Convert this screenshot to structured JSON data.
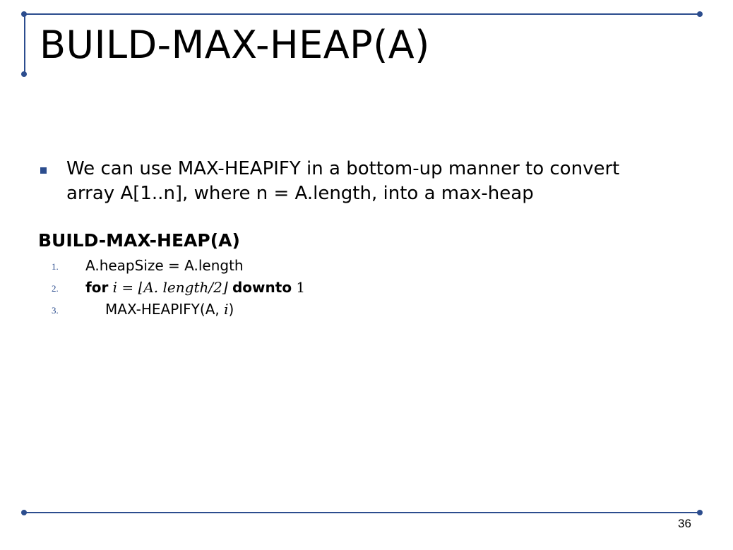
{
  "slide": {
    "title": "BUILD-MAX-HEAP(A)",
    "bullet": {
      "line1": "We can use MAX-HEAPIFY in a bottom-up manner to convert",
      "line2": "array A[1..n], where n = A.length, into a max-heap"
    },
    "algorithm": {
      "title": "BUILD-MAX-HEAP(A)",
      "lines": [
        {
          "number": "1.",
          "text": "A.heapSize = A.length"
        },
        {
          "number": "2.",
          "kw_for": "for",
          "var": "i",
          "eq": " = ",
          "floor_expr": "⌊A. length/2⌋",
          "kw_downto": "downto",
          "end": "1"
        },
        {
          "number": "3.",
          "call": "MAX-HEAPIFY(A, ",
          "arg": "i",
          "close": ")"
        }
      ]
    },
    "page_number": "36",
    "accent_color": "#2c4d8e"
  }
}
